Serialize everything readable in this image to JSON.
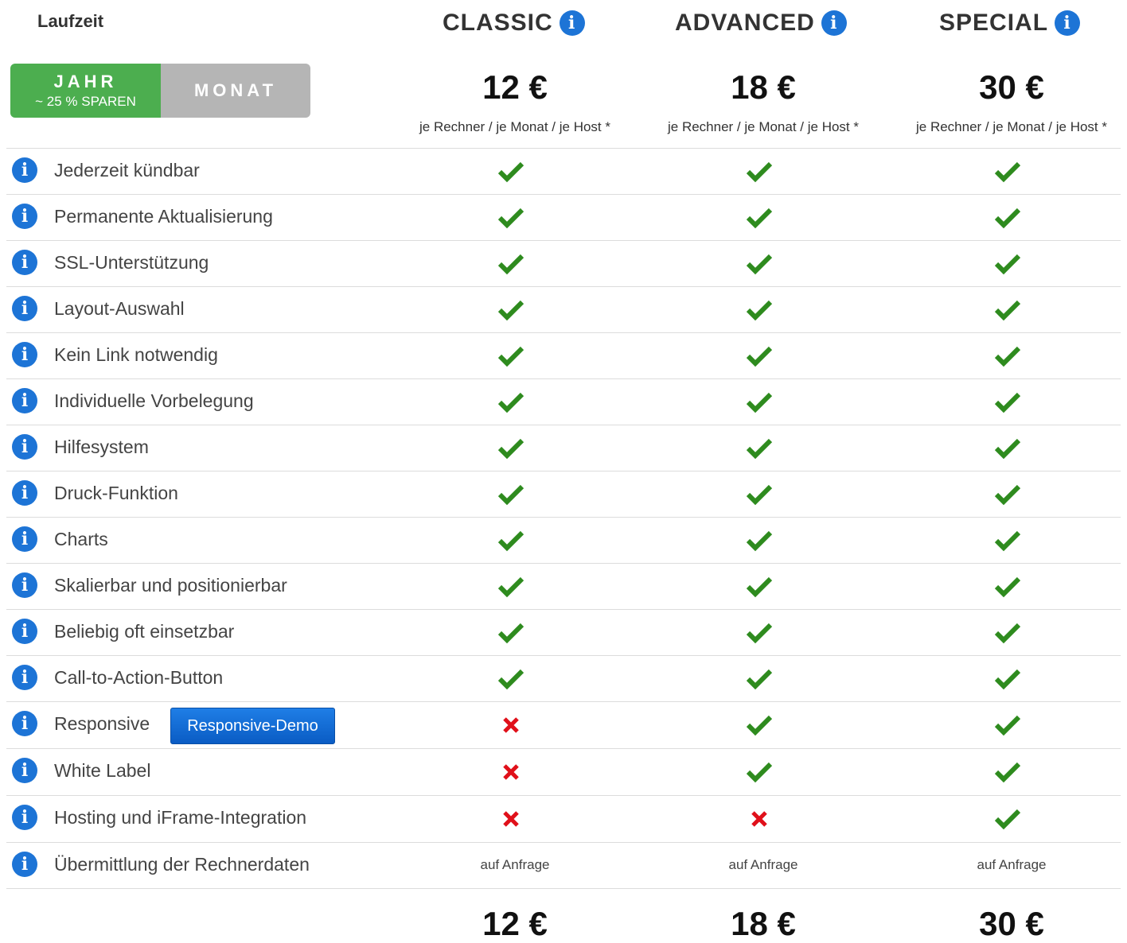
{
  "header": {
    "laufzeit": "Laufzeit",
    "toggle": {
      "year_label": "JAHR",
      "year_sub": "~ 25 % SPAREN",
      "month_label": "MONAT"
    }
  },
  "plans": [
    {
      "name": "CLASSIC",
      "price": "12 €",
      "per": "je Rechner / je Monat / je Host *"
    },
    {
      "name": "ADVANCED",
      "price": "18 €",
      "per": "je Rechner / je Monat / je Host *"
    },
    {
      "name": "SPECIAL",
      "price": "30 €",
      "per": "je Rechner / je Monat / je Host *"
    }
  ],
  "features": [
    {
      "label": "Jederzeit kündbar",
      "values": [
        "check",
        "check",
        "check"
      ]
    },
    {
      "label": "Permanente Aktualisierung",
      "values": [
        "check",
        "check",
        "check"
      ]
    },
    {
      "label": "SSL-Unterstützung",
      "values": [
        "check",
        "check",
        "check"
      ]
    },
    {
      "label": "Layout-Auswahl",
      "values": [
        "check",
        "check",
        "check"
      ]
    },
    {
      "label": "Kein Link notwendig",
      "values": [
        "check",
        "check",
        "check"
      ]
    },
    {
      "label": "Individuelle Vorbelegung",
      "values": [
        "check",
        "check",
        "check"
      ]
    },
    {
      "label": "Hilfesystem",
      "values": [
        "check",
        "check",
        "check"
      ]
    },
    {
      "label": "Druck-Funktion",
      "values": [
        "check",
        "check",
        "check"
      ]
    },
    {
      "label": "Charts",
      "values": [
        "check",
        "check",
        "check"
      ]
    },
    {
      "label": "Skalierbar und positionierbar",
      "values": [
        "check",
        "check",
        "check"
      ]
    },
    {
      "label": "Beliebig oft einsetzbar",
      "values": [
        "check",
        "check",
        "check"
      ]
    },
    {
      "label": "Call-to-Action-Button",
      "values": [
        "check",
        "check",
        "check"
      ]
    },
    {
      "label": "Responsive",
      "button": "Responsive-Demo",
      "values": [
        "cross",
        "check",
        "check"
      ]
    },
    {
      "label": "White Label",
      "values": [
        "cross",
        "check",
        "check"
      ]
    },
    {
      "label": "Hosting und iFrame-Integration",
      "values": [
        "cross",
        "cross",
        "check"
      ]
    },
    {
      "label": "Übermittlung der Rechnerdaten",
      "values": [
        "auf Anfrage",
        "auf Anfrage",
        "auf Anfrage"
      ]
    }
  ],
  "colors": {
    "check": "#2e8b1e",
    "cross": "#e0101a",
    "info": "#1d74d6",
    "year_toggle": "#4cae4f",
    "month_toggle": "#b5b5b5",
    "demo_button": "#1466d6"
  }
}
